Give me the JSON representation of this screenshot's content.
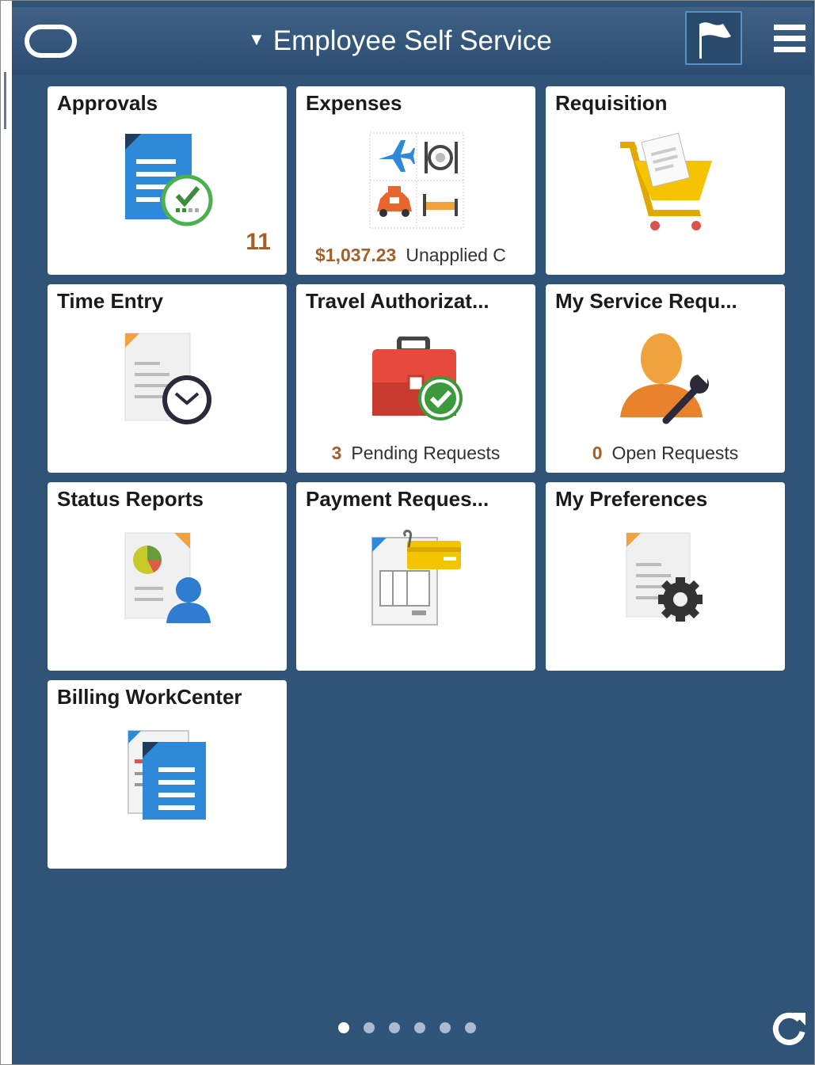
{
  "header": {
    "title": "Employee Self Service",
    "caret_icon": "triangle-down-icon",
    "logo_icon": "oracle-logo-icon",
    "flag_icon": "flag-icon",
    "menu_icon": "hamburger-menu-icon"
  },
  "tiles": [
    {
      "title": "Approvals",
      "icon": "document-check-icon",
      "count": "11"
    },
    {
      "title": "Expenses",
      "icon": "travel-expense-icon",
      "amount": "$1,037.23",
      "info": "Unapplied C"
    },
    {
      "title": "Requisition",
      "icon": "shopping-cart-icon"
    },
    {
      "title": "Time Entry",
      "icon": "document-clock-icon"
    },
    {
      "title": "Travel Authorizat...",
      "icon": "suitcase-check-icon",
      "count": "3",
      "info": "Pending Requests"
    },
    {
      "title": "My Service Requ...",
      "icon": "person-wrench-icon",
      "count": "0",
      "info": "Open Requests"
    },
    {
      "title": "Status Reports",
      "icon": "report-person-icon"
    },
    {
      "title": "Payment Reques...",
      "icon": "invoice-card-icon"
    },
    {
      "title": "My Preferences",
      "icon": "document-gear-icon"
    },
    {
      "title": "Billing WorkCenter",
      "icon": "documents-stack-icon"
    }
  ],
  "pagination": {
    "pages": 6,
    "active": 1
  },
  "refresh_icon": "refresh-icon",
  "colors": {
    "background": "#2f5477",
    "header": "#345a7e",
    "accent_number": "#a0612b",
    "tile": "#ffffff"
  }
}
